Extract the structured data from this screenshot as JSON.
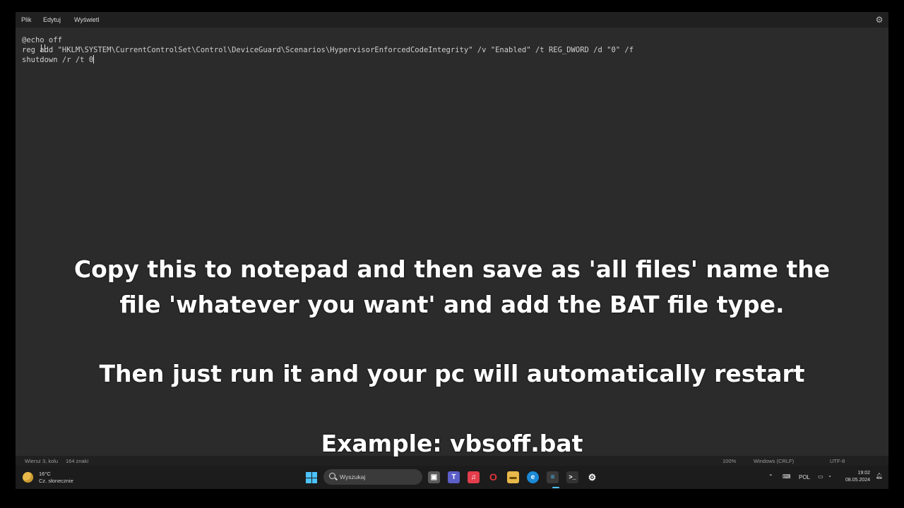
{
  "menu": {
    "file": "Plik",
    "edit": "Edytuj",
    "view": "Wyświetl"
  },
  "editor": {
    "lines": [
      "@echo off",
      "reg add \"HKLM\\SYSTEM\\CurrentControlSet\\Control\\DeviceGuard\\Scenarios\\HypervisorEnforcedCodeIntegrity\" /v \"Enabled\" /t REG_DWORD /d \"0\" /f",
      "shutdown /r /t 0"
    ]
  },
  "overlay": {
    "line1": "Copy this to notepad and then save as 'all files' name the",
    "line2": "file 'whatever you want' and add the BAT file type.",
    "line3": "Then just run it and your pc will automatically restart",
    "line4": "Example: vbsoff.bat"
  },
  "status": {
    "position": "Wiersz 3, kolu",
    "chars": "164 znaki",
    "zoom": "100%",
    "line_ending": "Windows (CRLF)",
    "encoding": "UTF-8"
  },
  "taskbar": {
    "weather_temp": "16°C",
    "weather_desc": "Cz. słonecznie",
    "search_placeholder": "Wyszukaj",
    "language": "POL",
    "time": "19:02",
    "date": "08.05.2024"
  },
  "icons": {
    "settings": "gear-icon",
    "start": "windows-start-icon",
    "search": "search-icon"
  },
  "colors": {
    "editor_bg": "#2b2b2b",
    "accent": "#4cc2ff",
    "opera_red": "#e0343b",
    "music_red": "#e23d4b"
  }
}
